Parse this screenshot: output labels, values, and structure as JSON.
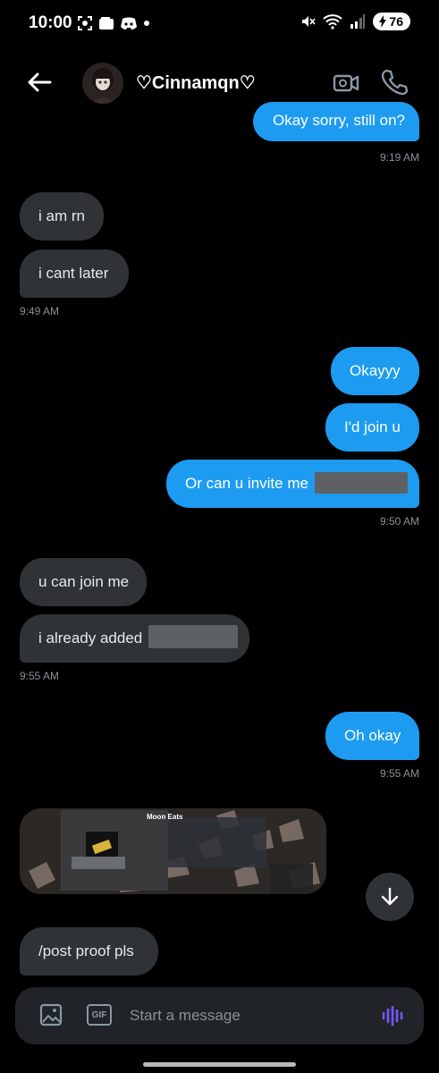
{
  "status_bar": {
    "time": "10:00",
    "battery": "76",
    "left_icons": [
      "screenshot-icon",
      "wallet-icon",
      "discord-icon",
      "dot-icon"
    ],
    "right_icons": [
      "mute-icon",
      "wifi-icon",
      "signal-icon"
    ]
  },
  "header": {
    "contact_name": "♡Cinnamqn♡",
    "icons": [
      "back-arrow-icon",
      "video-camera-icon",
      "phone-icon"
    ]
  },
  "messages": [
    {
      "direction": "out",
      "text": "Okay sorry, still on?"
    },
    {
      "direction": "in",
      "text": "i am rn"
    },
    {
      "direction": "in",
      "text": "i cant later"
    },
    {
      "direction": "out",
      "text": "Okayyy"
    },
    {
      "direction": "out",
      "text": "I'd join u"
    },
    {
      "direction": "out",
      "text": "Or can u invite me"
    },
    {
      "direction": "in",
      "text": "u can join me"
    },
    {
      "direction": "in",
      "text": "i already added"
    },
    {
      "direction": "out",
      "text": "Oh okay"
    },
    {
      "direction": "in",
      "text": "/post proof pls"
    }
  ],
  "timestamps": [
    "9:19 AM",
    "9:49 AM",
    "9:50 AM",
    "9:55 AM",
    "9:55 AM"
  ],
  "image_card": {
    "title": "Moon Eats"
  },
  "composer": {
    "placeholder": "Start a message",
    "gif_label": "GIF"
  },
  "colors": {
    "background": "#000000",
    "outgoing_bubble": "#1d9bf0",
    "incoming_bubble": "#2f3336",
    "voice_accent": "#7856ff"
  }
}
